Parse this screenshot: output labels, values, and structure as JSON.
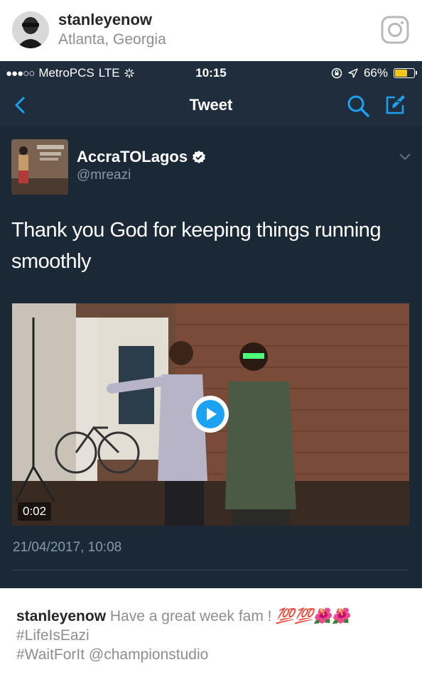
{
  "instagram": {
    "username": "stanleyenow",
    "location": "Atlanta, Georgia"
  },
  "status_bar": {
    "signal_dots": "●●●○○",
    "carrier": "MetroPCS",
    "network": "LTE",
    "time": "10:15",
    "battery": "66%",
    "battery_level": 0.66
  },
  "nav": {
    "title": "Tweet"
  },
  "tweet": {
    "display_name": "AccraTOLagos",
    "handle": "@mreazi",
    "text": "Thank you God for keeping things running smoothly",
    "timestamp": "21/04/2017, 10:08",
    "video": {
      "duration": "0:02"
    }
  },
  "caption": {
    "username": "stanleyenow",
    "text": "Have a great week fam !",
    "emojis": "💯💯🌺🌺",
    "hashtag1": "#LifeIsEazi",
    "hashtag2": "#WaitForIt @championstudio"
  },
  "colors": {
    "twitter_bg": "#1b2836",
    "twitter_bar": "#1f2d3c",
    "twitter_accent": "#1da1f2",
    "muted_text": "#8899a6",
    "battery_yellow": "#f5c518"
  }
}
